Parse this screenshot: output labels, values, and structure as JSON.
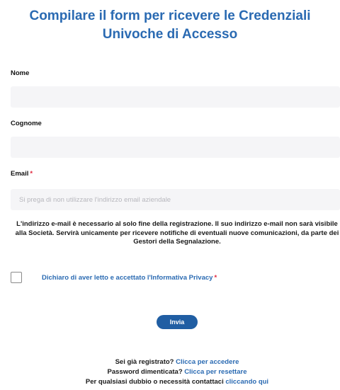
{
  "header": {
    "title": "Compilare il form per ricevere le Credenziali Univoche di Accesso"
  },
  "form": {
    "nome": {
      "label": "Nome",
      "value": "",
      "placeholder": ""
    },
    "cognome": {
      "label": "Cognome",
      "value": "",
      "placeholder": ""
    },
    "email": {
      "label": "Email",
      "required_marker": "*",
      "value": "",
      "placeholder": "Si prega di non utilizzare l'indirizzo email aziendale"
    },
    "notice": "L'indirizzo e-mail è necessario al solo fine della registrazione. Il suo indirizzo e-mail non sarà visibile alla Società. Servirà unicamente per ricevere notifiche di eventuali nuove comunicazioni, da parte dei Gestori della Segnalazione.",
    "privacy_consent": {
      "link_text": "Dichiaro di aver letto e accettato l'Informativa Privacy",
      "required_marker": "*",
      "checked": false
    },
    "submit_label": "Invia"
  },
  "footer": {
    "login_prompt": "Sei già registrato?",
    "login_link": "Clicca per accedere",
    "password_prompt": "Password dimenticata?",
    "password_link": "Clicca per resettare",
    "contact_prompt": "Per qualsiasi dubbio o necessità contattaci",
    "contact_link": "cliccando qui"
  },
  "colors": {
    "accent": "#2a6ab2",
    "button": "#205ea3",
    "required": "#e0243a",
    "input_bg": "#f5f5f7"
  }
}
